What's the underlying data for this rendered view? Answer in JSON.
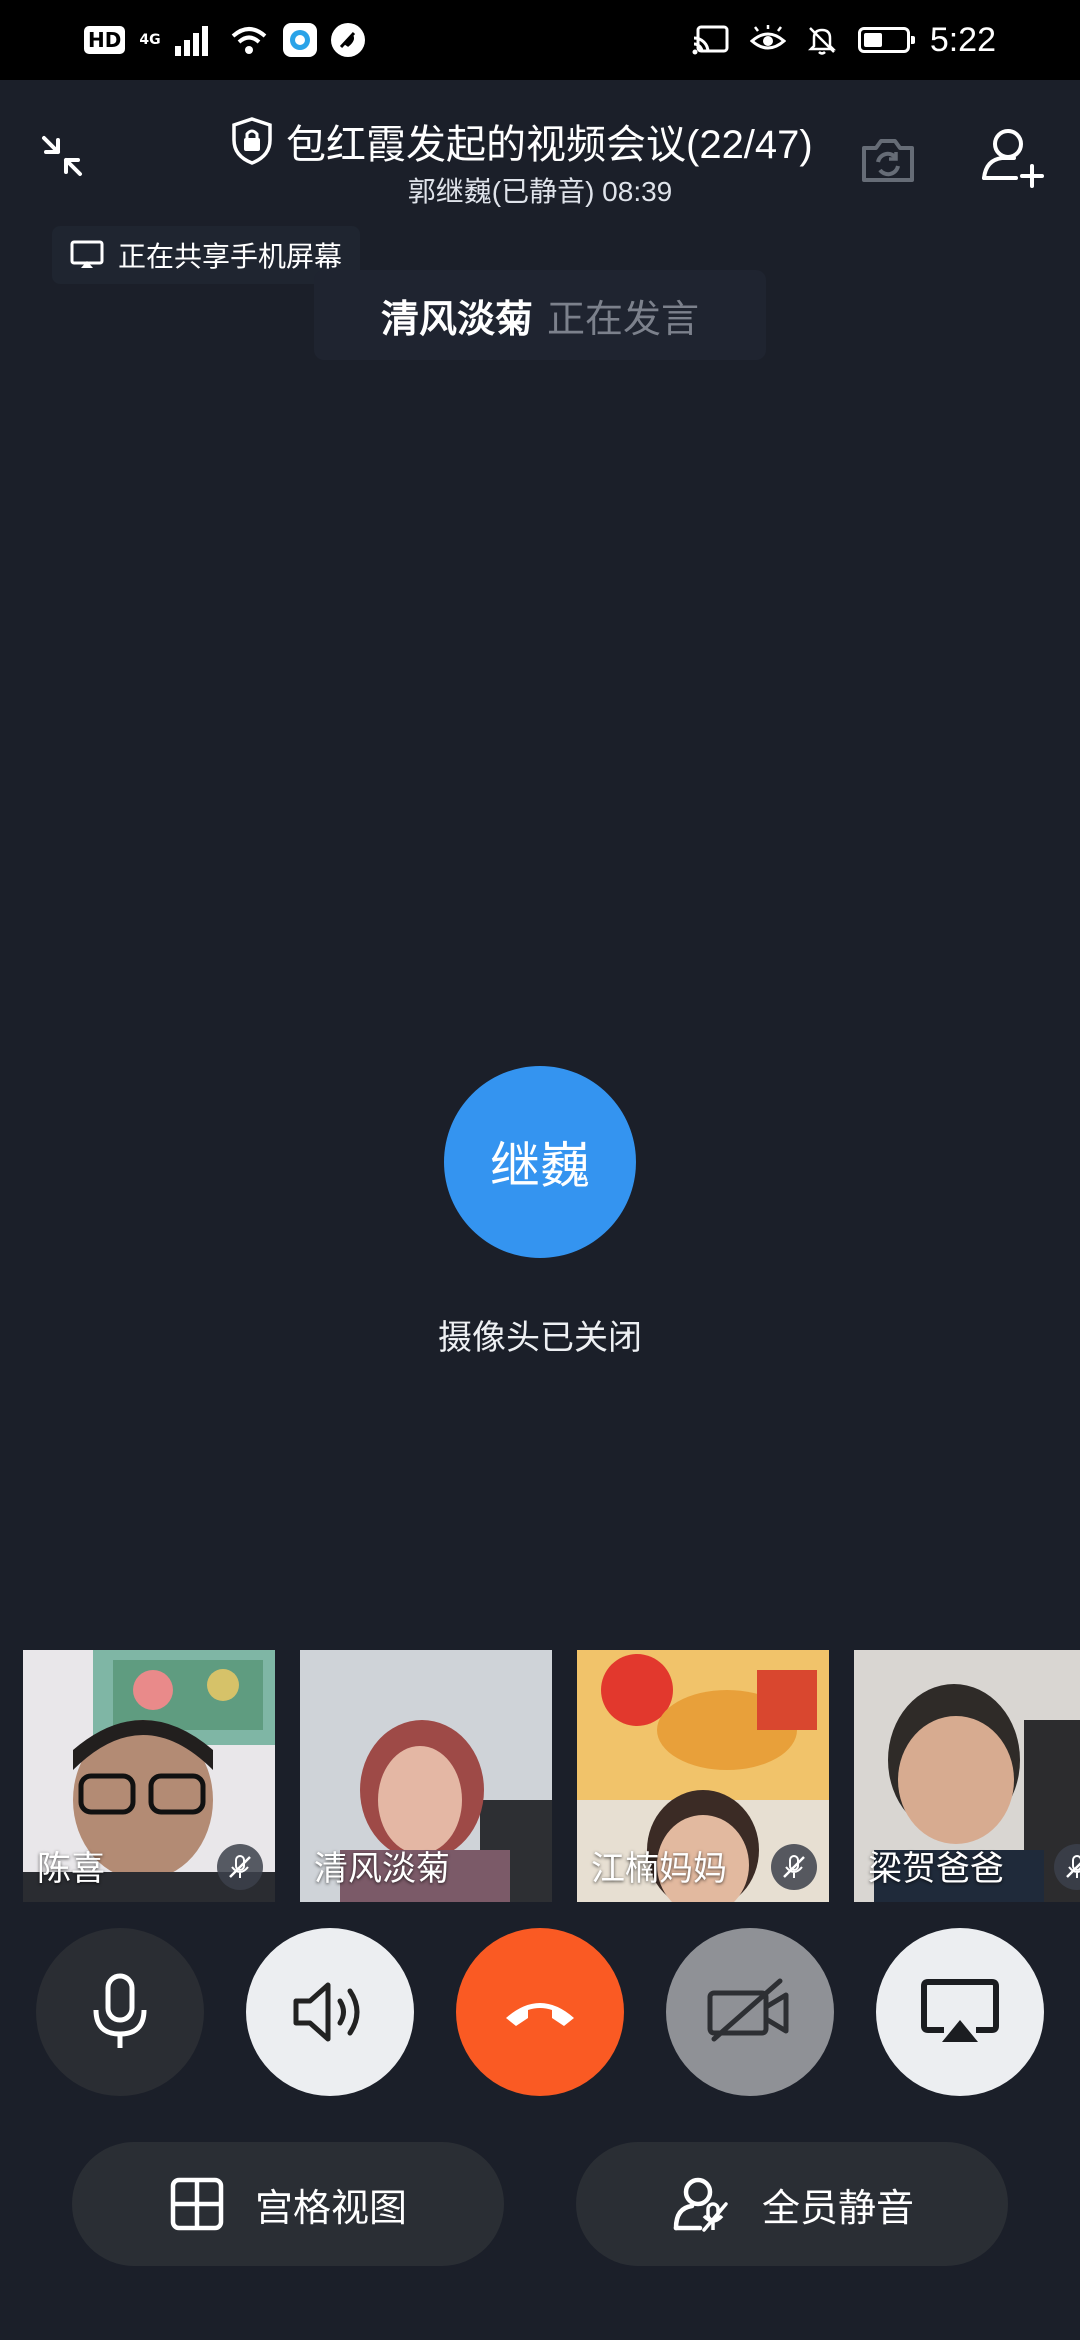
{
  "status_bar": {
    "hd": "HD",
    "network": "4G",
    "time": "5:22",
    "battery_level": 0.45
  },
  "header": {
    "title": "包红霞发起的视频会议(22/47)",
    "subtitle": "郭继巍(已静音) 08:39"
  },
  "share_notice": "正在共享手机屏幕",
  "speaker": {
    "name": "清风淡菊",
    "status": "正在发言"
  },
  "main_video": {
    "avatar_text": "继巍",
    "avatar_color": "#3494f0",
    "camera_status": "摄像头已关闭"
  },
  "participants": [
    {
      "name": "陈喜",
      "muted": true,
      "active": false
    },
    {
      "name": "清风淡菊",
      "muted": false,
      "active": true
    },
    {
      "name": "江楠妈妈",
      "muted": true,
      "active": false
    },
    {
      "name": "梁贺爸爸",
      "muted": true,
      "active": false
    }
  ],
  "controls": {
    "mic": "microphone-icon",
    "speaker": "speaker-icon",
    "hangup": "hangup-icon",
    "camera": "camera-off-icon",
    "screen_share": "screen-share-icon",
    "hangup_color": "#fa5a23"
  },
  "bottom_actions": {
    "grid_view": "宫格视图",
    "mute_all": "全员静音"
  }
}
